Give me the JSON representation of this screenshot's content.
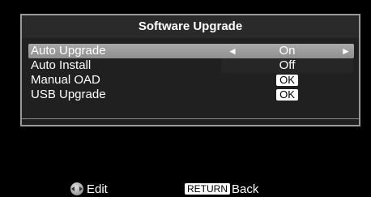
{
  "dialog": {
    "title": "Software Upgrade",
    "items": [
      {
        "label": "Auto Upgrade",
        "value": "On",
        "left_arrow": "◄",
        "right_arrow": "►"
      },
      {
        "label": "Auto Install",
        "value": "Off"
      },
      {
        "label": "Manual OAD",
        "button": "OK"
      },
      {
        "label": "USB Upgrade",
        "button": "OK"
      }
    ]
  },
  "footer": {
    "edit_label": "Edit",
    "return_key": "RETURN",
    "back_label": "Back"
  },
  "colors": {
    "background": "#000000",
    "panel": "#202020",
    "selected_row": "#9f9f9f",
    "button": "#ffffff"
  }
}
